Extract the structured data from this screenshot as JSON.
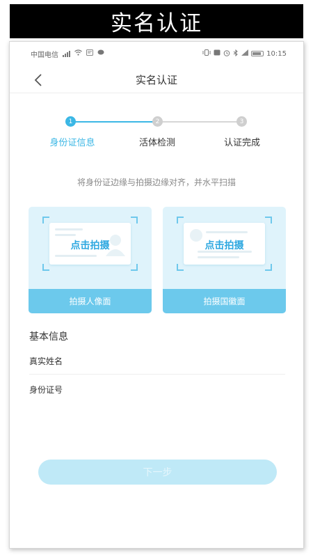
{
  "banner": {
    "title": "实名认证"
  },
  "statusbar": {
    "carrier": "中国电信",
    "time": "10:15"
  },
  "navbar": {
    "title": "实名认证"
  },
  "stepper": {
    "active_color": "#3bb7e5",
    "inactive_color": "#cfcfcf",
    "steps": [
      {
        "number": "1",
        "label": "身份证信息",
        "active": true
      },
      {
        "number": "2",
        "label": "活体检测",
        "active": false
      },
      {
        "number": "3",
        "label": "认证完成",
        "active": false
      }
    ]
  },
  "hint": "将身份证边缘与拍摄边缘对齐，并水平扫描",
  "cards": [
    {
      "shoot_label": "点击拍摄",
      "bottom_label": "拍摄人像面"
    },
    {
      "shoot_label": "点击拍摄",
      "bottom_label": "拍摄国徽面"
    }
  ],
  "basic_info": {
    "title": "基本信息",
    "fields": [
      {
        "label": "真实姓名"
      },
      {
        "label": "身份证号"
      }
    ]
  },
  "next_button": {
    "label": "下一步",
    "color": "#bfe9f7"
  }
}
